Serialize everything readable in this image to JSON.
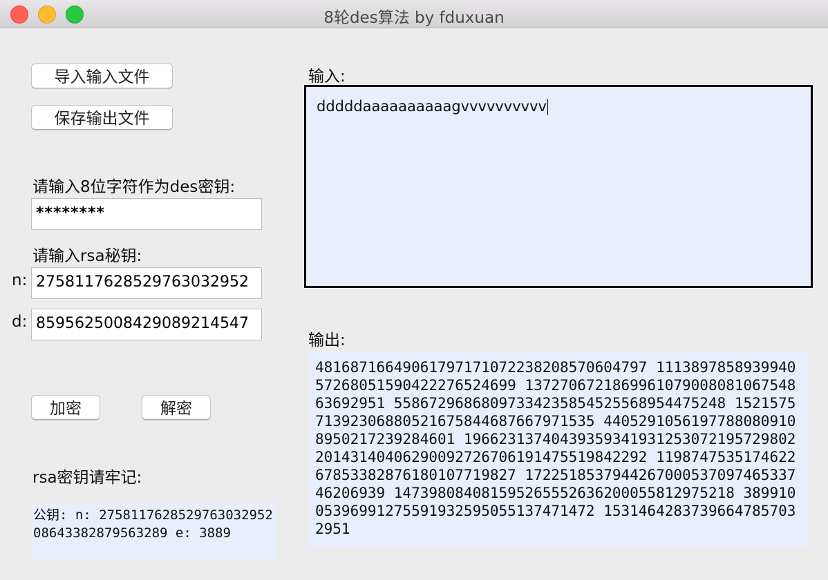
{
  "window": {
    "title": "8轮des算法 by fduxuan"
  },
  "buttons": {
    "import_file": "导入输入文件",
    "save_file": "保存输出文件",
    "encrypt": "加密",
    "decrypt": "解密"
  },
  "des": {
    "label": "请输入8位字符作为des密钥:",
    "value": "********"
  },
  "rsa": {
    "label": "请输入rsa秘钥:",
    "n_label": "n:",
    "n_value": "2758117628529763032952",
    "d_label": "d:",
    "d_value": "8595625008429089214547",
    "remember_label": "rsa密钥请牢记:",
    "public_key_text": "公钥: n: 27581176285297630329520864338287956328​9 e: 3889"
  },
  "input": {
    "label": "输入:",
    "text": "dddddaaaaaaaaaagvvvvvvvvvv"
  },
  "output": {
    "label": "输出:",
    "text": "4816871664906179717107223820857060479​7 11138978589399405726805159042227652469​9 1372706721869961079008081067548636929​51 5586729686809733423585452556895447524​8 152157571392306880521675844687667971535 44052910561977880809108950217239284601 196623137404393593419312530721957298​02 2014314040629009272670619147551984229​2 1198747535174622678533828761801077198​27 1722518537944267000537097465337462069​39 1473980840815952655526362000558129752​18 3899100539699127559193259505513747147​2 153146428373966478570329​51"
  },
  "colors": {
    "textarea_bg": "#e8eefb",
    "window_bg": "#ececec",
    "close": "#fe5f57",
    "minimize": "#febc2e",
    "maximize": "#28c840"
  }
}
